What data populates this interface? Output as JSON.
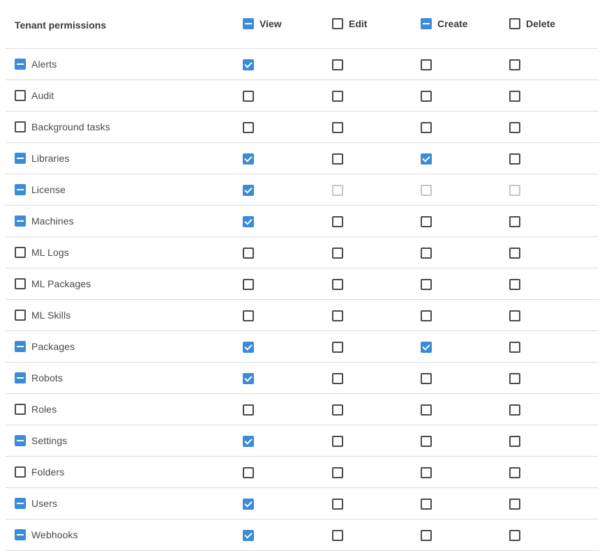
{
  "header": {
    "title": "Tenant permissions",
    "columns": [
      {
        "key": "view",
        "label": "View",
        "state": "indeterminate"
      },
      {
        "key": "edit",
        "label": "Edit",
        "state": "unchecked"
      },
      {
        "key": "create",
        "label": "Create",
        "state": "indeterminate"
      },
      {
        "key": "delete",
        "label": "Delete",
        "state": "unchecked"
      }
    ]
  },
  "colors": {
    "accent": "#3b8bd6",
    "border": "#4a4a4a",
    "disabled_border": "#c4c4c4",
    "divider": "#dcdcdc"
  },
  "rows": [
    {
      "name": "Alerts",
      "row_state": "indeterminate",
      "view": "checked",
      "edit": "unchecked",
      "create": "unchecked",
      "delete": "unchecked"
    },
    {
      "name": "Audit",
      "row_state": "unchecked",
      "view": "unchecked",
      "edit": "unchecked",
      "create": "unchecked",
      "delete": "unchecked"
    },
    {
      "name": "Background tasks",
      "row_state": "unchecked",
      "view": "unchecked",
      "edit": "unchecked",
      "create": "unchecked",
      "delete": "unchecked"
    },
    {
      "name": "Libraries",
      "row_state": "indeterminate",
      "view": "checked",
      "edit": "unchecked",
      "create": "checked",
      "delete": "unchecked"
    },
    {
      "name": "License",
      "row_state": "indeterminate",
      "view": "checked",
      "edit": "disabled",
      "create": "disabled",
      "delete": "disabled"
    },
    {
      "name": "Machines",
      "row_state": "indeterminate",
      "view": "checked",
      "edit": "unchecked",
      "create": "unchecked",
      "delete": "unchecked"
    },
    {
      "name": "ML Logs",
      "row_state": "unchecked",
      "view": "unchecked",
      "edit": "unchecked",
      "create": "unchecked",
      "delete": "unchecked"
    },
    {
      "name": "ML Packages",
      "row_state": "unchecked",
      "view": "unchecked",
      "edit": "unchecked",
      "create": "unchecked",
      "delete": "unchecked"
    },
    {
      "name": "ML Skills",
      "row_state": "unchecked",
      "view": "unchecked",
      "edit": "unchecked",
      "create": "unchecked",
      "delete": "unchecked"
    },
    {
      "name": "Packages",
      "row_state": "indeterminate",
      "view": "checked",
      "edit": "unchecked",
      "create": "checked",
      "delete": "unchecked"
    },
    {
      "name": "Robots",
      "row_state": "indeterminate",
      "view": "checked",
      "edit": "unchecked",
      "create": "unchecked",
      "delete": "unchecked"
    },
    {
      "name": "Roles",
      "row_state": "unchecked",
      "view": "unchecked",
      "edit": "unchecked",
      "create": "unchecked",
      "delete": "unchecked"
    },
    {
      "name": "Settings",
      "row_state": "indeterminate",
      "view": "checked",
      "edit": "unchecked",
      "create": "unchecked",
      "delete": "unchecked"
    },
    {
      "name": "Folders",
      "row_state": "unchecked",
      "view": "unchecked",
      "edit": "unchecked",
      "create": "unchecked",
      "delete": "unchecked"
    },
    {
      "name": "Users",
      "row_state": "indeterminate",
      "view": "checked",
      "edit": "unchecked",
      "create": "unchecked",
      "delete": "unchecked"
    },
    {
      "name": "Webhooks",
      "row_state": "indeterminate",
      "view": "checked",
      "edit": "unchecked",
      "create": "unchecked",
      "delete": "unchecked"
    }
  ]
}
